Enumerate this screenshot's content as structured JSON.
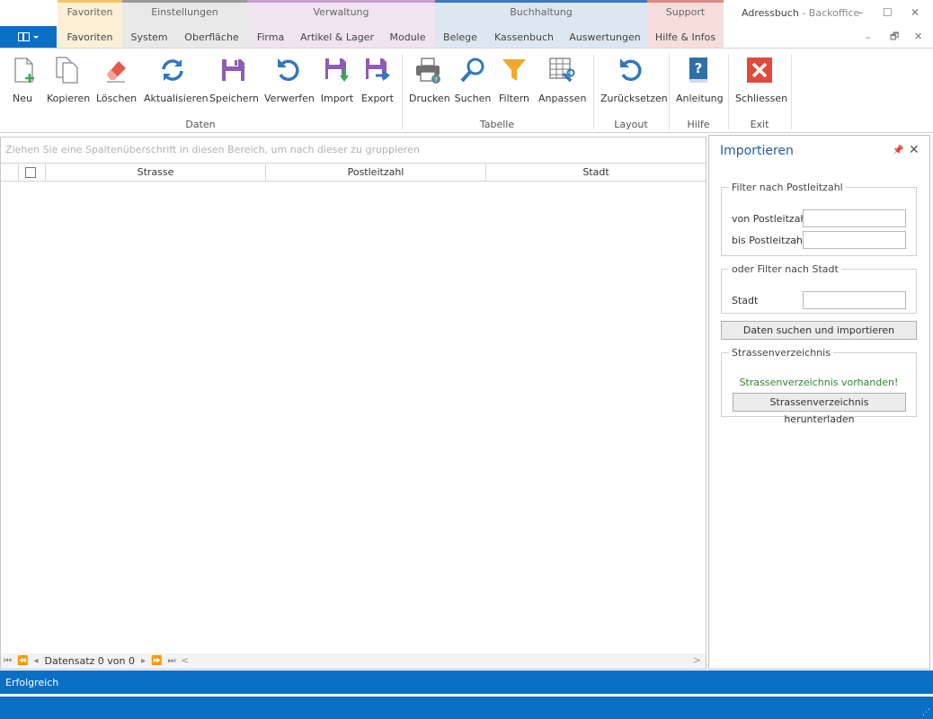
{
  "window": {
    "app_name": "Adressbuch",
    "separator": " - ",
    "context": "Backoffice",
    "minimize": "–",
    "maximize": "☐",
    "close": "✕",
    "inner_minimize": "–",
    "inner_restore": "🗗",
    "inner_close": "✕"
  },
  "categories": {
    "favoriten": "Favoriten",
    "einstellungen": "Einstellungen",
    "verwaltung": "Verwaltung",
    "buchhaltung": "Buchhaltung",
    "support": "Support"
  },
  "tabs": {
    "favoriten": "Favoriten",
    "system": "System",
    "oberflaeche": "Oberfläche",
    "firma": "Firma",
    "artikel_lager": "Artikel & Lager",
    "module": "Module",
    "belege": "Belege",
    "kassenbuch": "Kassenbuch",
    "auswertungen": "Auswertungen",
    "hilfe_infos": "Hilfe & Infos"
  },
  "ribbon": {
    "buttons": {
      "neu": "Neu",
      "kopieren": "Kopieren",
      "loeschen": "Löschen",
      "aktualisieren": "Aktualisieren",
      "speichern": "Speichern",
      "verwerfen": "Verwerfen",
      "import": "Import",
      "export": "Export",
      "drucken": "Drucken",
      "suchen": "Suchen",
      "filtern": "Filtern",
      "anpassen": "Anpassen",
      "zuruecksetzen": "Zurücksetzen",
      "anleitung": "Anleitung",
      "schliessen": "Schliessen"
    },
    "groups": {
      "daten": "Daten",
      "tabelle": "Tabelle",
      "layout": "Layout",
      "hilfe": "Hilfe",
      "exit": "Exit"
    }
  },
  "grid": {
    "group_panel_hint": "Ziehen Sie eine Spaltenüberschrift in diesen Bereich, um nach dieser zu gruppieren",
    "columns": {
      "strasse": "Strasse",
      "postleitzahl": "Postleitzahl",
      "stadt": "Stadt"
    },
    "navigator": {
      "first": "⏮",
      "prev_page": "⏪",
      "prev": "◂",
      "record_text": "Datensatz 0 von 0",
      "next": "▸",
      "next_page": "⏩",
      "last": "⏭",
      "scroll_left": "<",
      "scroll_right": ">"
    }
  },
  "import_panel": {
    "title": "Importieren",
    "pin": "📌",
    "close": "✕",
    "filter_plz": {
      "legend": "Filter nach Postleitzahl",
      "von_label": "von Postleitzahl",
      "von_value": "",
      "bis_label": "bis Postleitzahl",
      "bis_value": ""
    },
    "filter_stadt": {
      "legend": "oder Filter nach Stadt",
      "stadt_label": "Stadt",
      "stadt_value": ""
    },
    "search_button": "Daten suchen und importieren",
    "streets": {
      "legend": "Strassenverzeichnis",
      "status": "Strassenverzeichnis vorhanden!",
      "download_button": "Strassenverzeichnis herunterladen"
    }
  },
  "status": {
    "text": "Erfolgreich",
    "grip": "⋰"
  },
  "colors": {
    "accent_blue": "#0c6fc6",
    "panel_title_blue": "#1f5fa8",
    "success_green": "#2c8a2c"
  }
}
